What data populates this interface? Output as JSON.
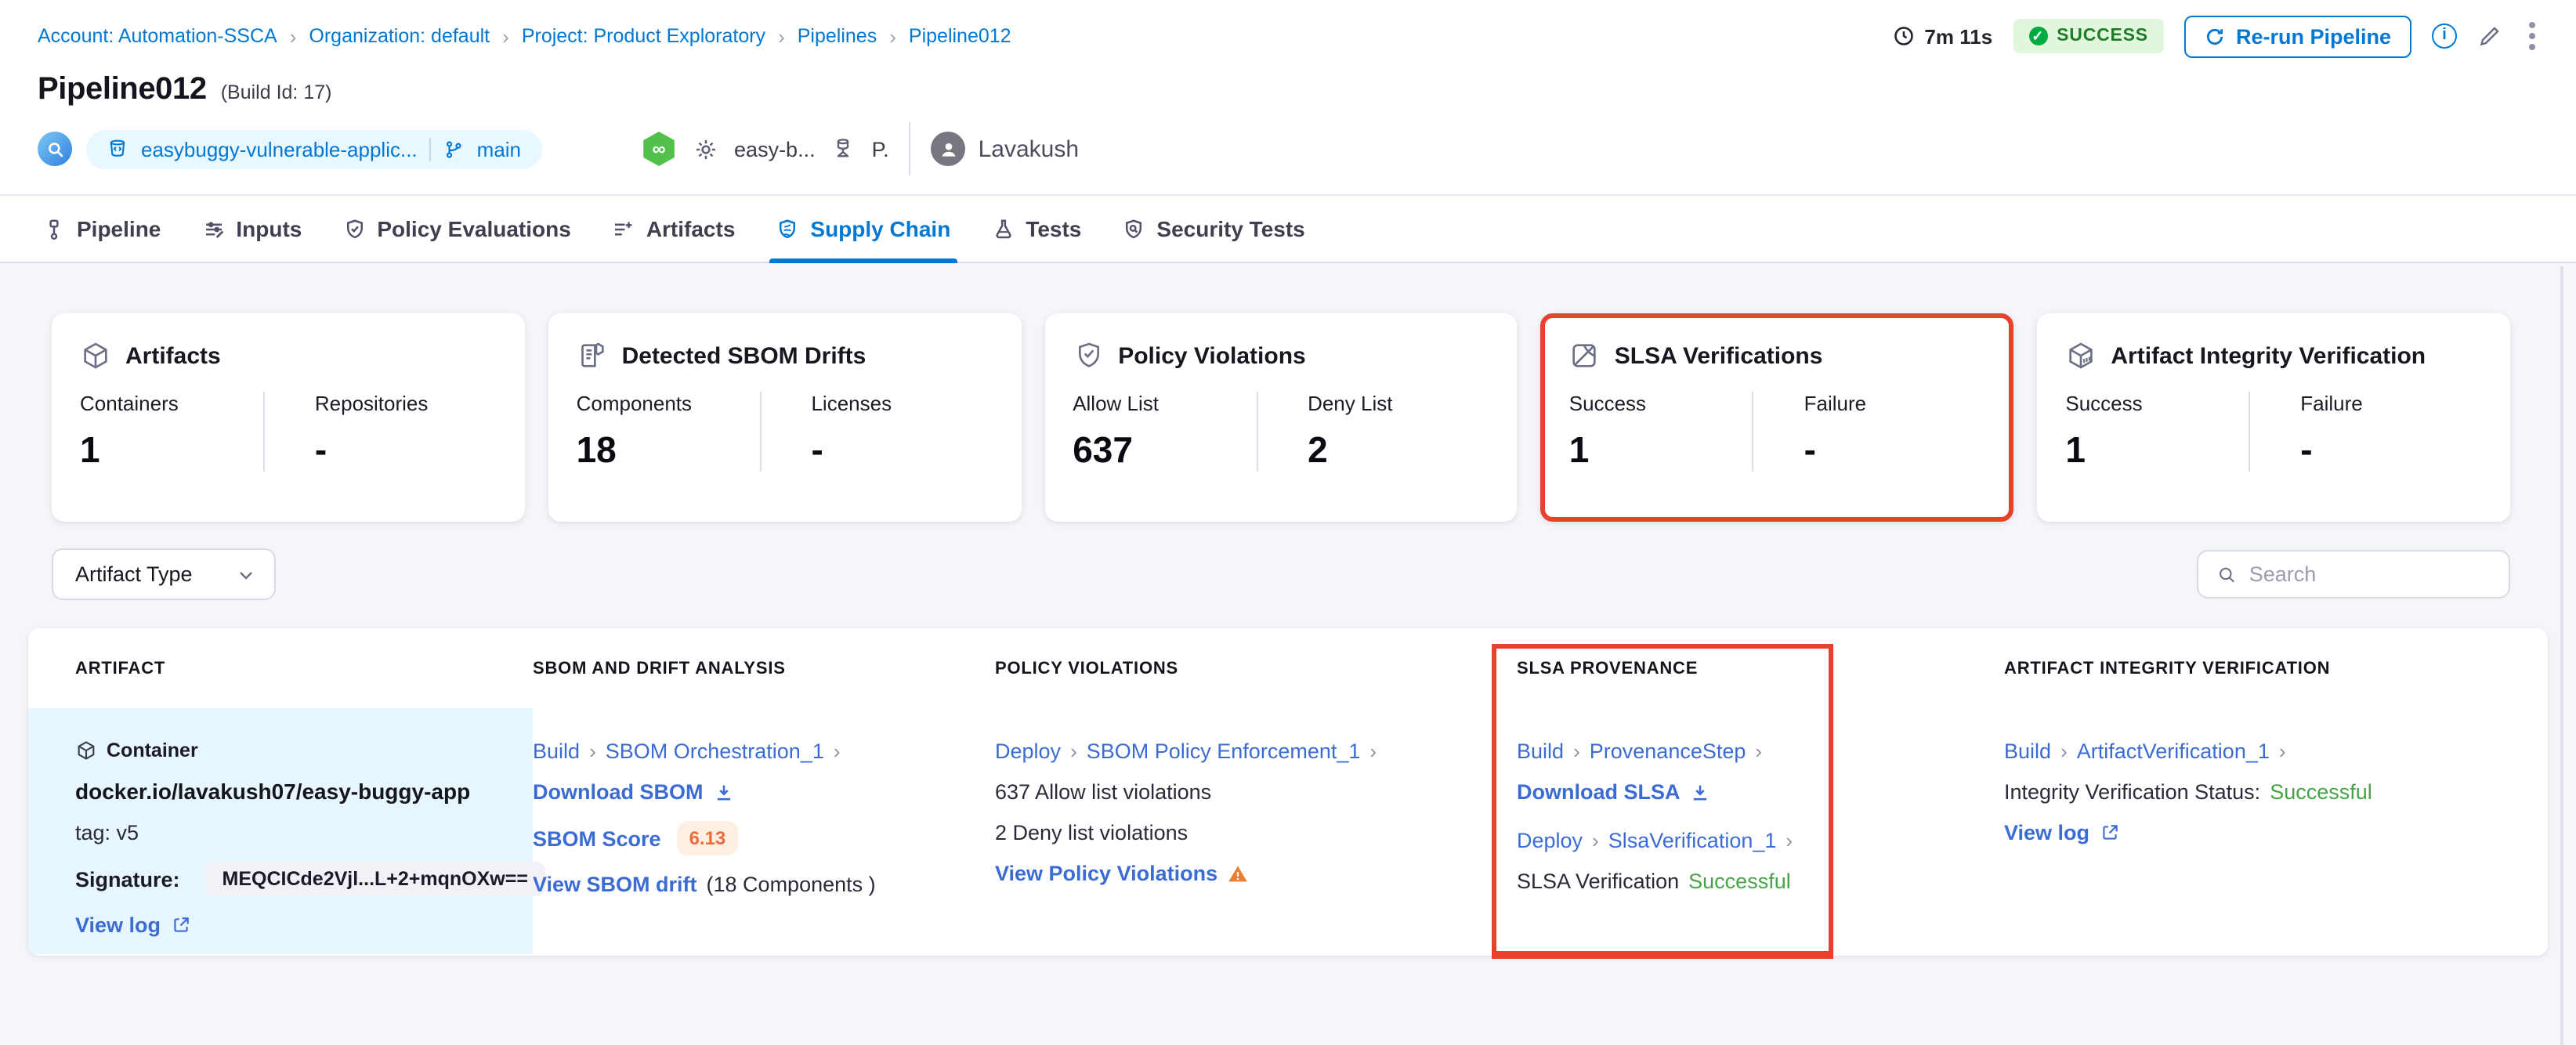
{
  "ui": {
    "chevron": "›"
  },
  "colors": {
    "accent": "#0278d5",
    "annotation_red": "#e8412c",
    "success_green": "#46a446",
    "warning_orange": "#ee7d2f",
    "score_orange": "#e96d3c"
  },
  "breadcrumb": {
    "items": [
      "Account: Automation-SSCA",
      "Organization: default",
      "Project: Product Exploratory",
      "Pipelines",
      "Pipeline012"
    ]
  },
  "topbar": {
    "duration": "7m 11s",
    "status": "SUCCESS",
    "rerun": "Re-run Pipeline"
  },
  "title": {
    "name": "Pipeline012",
    "build": "(Build Id: 17)"
  },
  "meta": {
    "repo": "easybuggy-vulnerable-applic...",
    "branch": "main",
    "trigger": "easy-b...",
    "trigger_user": "P.",
    "user": "Lavakush"
  },
  "tabs": [
    "Pipeline",
    "Inputs",
    "Policy Evaluations",
    "Artifacts",
    "Supply Chain",
    "Tests",
    "Security Tests"
  ],
  "cards": [
    {
      "title": "Artifacts",
      "stats": [
        {
          "label": "Containers",
          "value": "1"
        },
        {
          "label": "Repositories",
          "value": "-"
        }
      ]
    },
    {
      "title": "Detected SBOM Drifts",
      "stats": [
        {
          "label": "Components",
          "value": "18"
        },
        {
          "label": "Licenses",
          "value": "-"
        }
      ]
    },
    {
      "title": "Policy Violations",
      "stats": [
        {
          "label": "Allow List",
          "value": "637"
        },
        {
          "label": "Deny List",
          "value": "2"
        }
      ]
    },
    {
      "title": "SLSA Verifications",
      "stats": [
        {
          "label": "Success",
          "value": "1"
        },
        {
          "label": "Failure",
          "value": "-"
        }
      ]
    },
    {
      "title": "Artifact Integrity Verification",
      "stats": [
        {
          "label": "Success",
          "value": "1"
        },
        {
          "label": "Failure",
          "value": "-"
        }
      ]
    }
  ],
  "filters": {
    "artifact_type": "Artifact Type",
    "search_placeholder": "Search"
  },
  "table": {
    "headers": [
      "ARTIFACT",
      "SBOM AND DRIFT ANALYSIS",
      "POLICY VIOLATIONS",
      "SLSA PROVENANCE",
      "ARTIFACT INTEGRITY VERIFICATION"
    ],
    "row": {
      "artifact": {
        "type": "Container",
        "image": "docker.io/lavakush07/easy-buggy-app",
        "tag": "tag: v5",
        "signature_label": "Signature:",
        "signature": "MEQCICde2Vjl...L+2+mqnOXw==",
        "view_log": "View log"
      },
      "sbom": {
        "stage": "Build",
        "step": "SBOM Orchestration_1",
        "download": "Download SBOM",
        "score_label": "SBOM Score",
        "score": "6.13",
        "drift": "View SBOM drift",
        "drift_count": "(18 Components )"
      },
      "policy": {
        "stage": "Deploy",
        "step": "SBOM Policy Enforcement_1",
        "allow": "637 Allow list violations",
        "deny": "2 Deny list violations",
        "view": "View Policy Violations"
      },
      "slsa": {
        "stage1": "Build",
        "step1": "ProvenanceStep",
        "download": "Download SLSA",
        "stage2": "Deploy",
        "step2": "SlsaVerification_1",
        "status_label": "SLSA Verification",
        "status": "Successful"
      },
      "integrity": {
        "stage": "Build",
        "step": "ArtifactVerification_1",
        "status_label": "Integrity Verification Status:",
        "status": "Successful",
        "view_log": "View log"
      }
    }
  }
}
